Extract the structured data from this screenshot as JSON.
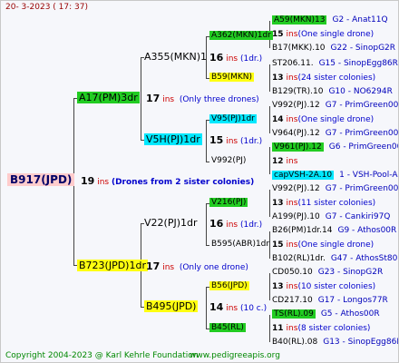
{
  "header": {
    "date": "20-  3-2023 ( 17: 37)"
  },
  "footer": {
    "copyright": "Copyright 2004-2023 @ Karl Kehrle Foundation",
    "url": "www.pedigreeapis.org"
  },
  "root": {
    "id": "B917(JPD)",
    "num": "19",
    "ins": "ins",
    "note": "(Drones from 2 sister colonies)"
  },
  "mother": {
    "id": "A17(PM)3dr",
    "num": "17",
    "ins": "ins",
    "note": "(Only three drones)"
  },
  "father": {
    "id": "B723(JPD)1dr",
    "num": "17",
    "ins": "ins",
    "note": "(Only one drone)"
  },
  "mm": {
    "id": "A355(MKN)1",
    "num": "16",
    "ins": "ins",
    "note": "(1dr.)"
  },
  "mf": {
    "id": "V5H(PJ)1dr",
    "num": "15",
    "ins": "ins",
    "note": "(1dr.)"
  },
  "fm": {
    "id": "V22(PJ)1dr",
    "num": "16",
    "ins": "ins",
    "note": "(1dr.)"
  },
  "ff": {
    "id": "B495(JPD)",
    "num": "14",
    "ins": "ins",
    "note": "(10 c.)"
  },
  "g3": {
    "a362": {
      "id": "A362(MKN)1dr"
    },
    "b59": {
      "id": "B59(MKN)"
    },
    "v95": {
      "id": "V95(PJ)1dr"
    },
    "v992": {
      "id": "V992(PJ)"
    },
    "v216": {
      "id": "V216(PJ)"
    },
    "b595": {
      "id": "B595(ABR)1dr"
    },
    "b56": {
      "id": "B56(JPD)"
    },
    "b45": {
      "id": "B45(RL)"
    }
  },
  "g4": [
    {
      "id": "A59(MKN)13",
      "info": "G2 - Anat11Q"
    },
    {
      "num": "15",
      "ins": "ins",
      "note": "(One single drone)"
    },
    {
      "id": "B17(MKK).10",
      "info": "G22 - SinopG2R"
    },
    {
      "id": "ST206.11.",
      "info": "G15 - SinopEgg86R"
    },
    {
      "num": "13",
      "ins": "ins",
      "note": "(24 sister colonies)"
    },
    {
      "id": "B129(TR).10",
      "info": "G10 - NO6294R"
    },
    {
      "id": "V992(PJ).12",
      "info": "G7 - PrimGreen00"
    },
    {
      "num": "14",
      "ins": "ins",
      "note": "(One single drone)"
    },
    {
      "id": "V964(PJ).12",
      "info": "G7 - PrimGreen00"
    },
    {
      "id": "V961(PJ).12",
      "info": "G6 - PrimGreen00"
    },
    {
      "num": "12",
      "ins": "ins",
      "note": ""
    },
    {
      "id": "capVSH-2A.10",
      "info": "1 - VSH-Pool-AR"
    },
    {
      "id": "V992(PJ).12",
      "info": "G7 - PrimGreen00"
    },
    {
      "num": "13",
      "ins": "ins",
      "note": "(11 sister colonies)"
    },
    {
      "id": "A199(PJ).10",
      "info": "G7 - Cankiri97Q"
    },
    {
      "id": "B26(PM)1dr.14",
      "info": "G9 - Athos00R"
    },
    {
      "num": "15",
      "ins": "ins",
      "note": "(One single drone)"
    },
    {
      "id": "B102(RL)1dr.",
      "info": "G47 - AthosSt80R"
    },
    {
      "id": "CD050.10",
      "info": "G23 - SinopG2R"
    },
    {
      "num": "13",
      "ins": "ins",
      "note": "(10 sister colonies)"
    },
    {
      "id": "CD217.10",
      "info": "G17 - Longos77R"
    },
    {
      "id": "TS(RL).09",
      "info": "G5 - Athos00R"
    },
    {
      "num": "11",
      "ins": "ins",
      "note": "(8 sister colonies)"
    },
    {
      "id": "B40(RL).08",
      "info": "G13 - SinopEgg86R"
    }
  ]
}
